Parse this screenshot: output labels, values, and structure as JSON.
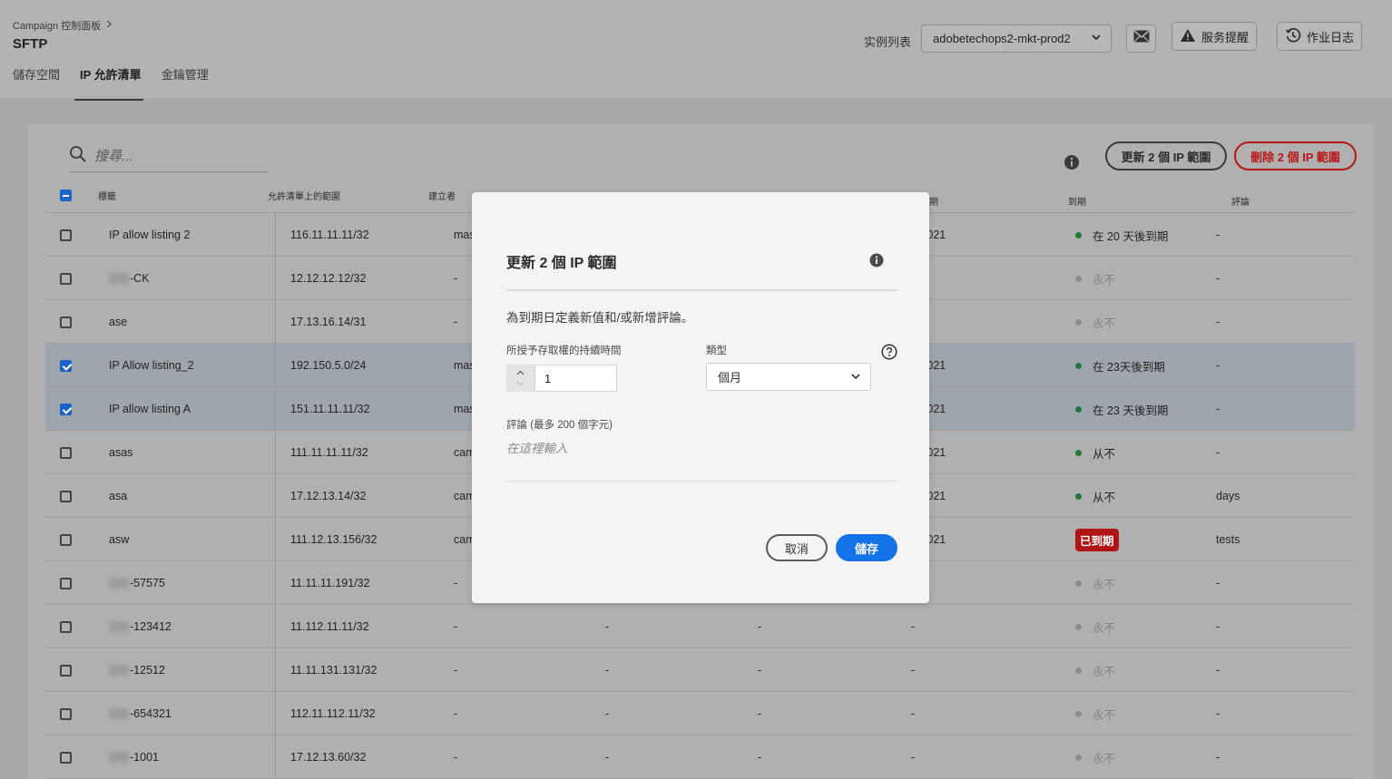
{
  "header": {
    "breadcrumb": "Campaign 控制面板",
    "title": "SFTP",
    "tabs": [
      "儲存空間",
      "IP 允許清單",
      "金鑰管理"
    ],
    "instance_label": "实例列表",
    "instance_value": "adobetechops2-mkt-prod2",
    "service_alerts": "服务提醒",
    "job_log": "作业日志"
  },
  "toolbar": {
    "search_placeholder": "搜尋...",
    "update_button": "更新 2 個 IP 範圍",
    "delete_button": "刪除 2 個 IP 範圍"
  },
  "table": {
    "columns": [
      "標籤",
      "允許清單上的範圍",
      "建立者",
      "期",
      "到期",
      "評論"
    ],
    "rows": [
      {
        "label": "IP allow listing 2",
        "blur": false,
        "range": "116.11.11.11/32",
        "creator": "mas",
        "c4": "",
        "c5": "",
        "date": "1/2021",
        "expiry": "在 20 天後到期",
        "expiry_type": "green",
        "comment": "-",
        "selected": false
      },
      {
        "label": "-CK",
        "blur": true,
        "range": "12.12.12.12/32",
        "creator": "-",
        "c4": "",
        "c5": "",
        "date": "",
        "expiry": "永不",
        "expiry_type": "gray",
        "comment": "-",
        "selected": false
      },
      {
        "label": "ase",
        "blur": false,
        "range": "17.13.16.14/31",
        "creator": "-",
        "c4": "",
        "c5": "",
        "date": "",
        "expiry": "永不",
        "expiry_type": "gray",
        "comment": "-",
        "selected": false
      },
      {
        "label": "IP Allow listing_2",
        "blur": false,
        "range": "192.150.5.0/24",
        "creator": "mas",
        "c4": "",
        "c5": "",
        "date": "5/2021",
        "expiry": "在 23天後到期",
        "expiry_type": "green",
        "comment": "-",
        "selected": true
      },
      {
        "label": "IP allow listing A",
        "blur": false,
        "range": "151.11.11.11/32",
        "creator": "mas",
        "c4": "",
        "c5": "",
        "date": "5/2021",
        "expiry": "在 23 天後到期",
        "expiry_type": "green",
        "comment": "-",
        "selected": true
      },
      {
        "label": "asas",
        "blur": false,
        "range": "111.11.11.11/32",
        "creator": "cam",
        "c4": "",
        "c5": "",
        "date": "5/2021",
        "expiry": "从不",
        "expiry_type": "green",
        "comment": "-",
        "selected": false
      },
      {
        "label": "asa",
        "blur": false,
        "range": "17.12.13.14/32",
        "creator": "cam",
        "c4": "",
        "c5": "",
        "date": "5/2021",
        "expiry": "从不",
        "expiry_type": "green",
        "comment": "days",
        "selected": false
      },
      {
        "label": "asw",
        "blur": false,
        "range": "111.12.13.156/32",
        "creator": "cam",
        "c4": "",
        "c5": "",
        "date": "7/2021",
        "expiry": "已到期",
        "expiry_type": "expired",
        "comment": "tests",
        "selected": false
      },
      {
        "label": "-57575",
        "blur": true,
        "range": "11.11.11.191/32",
        "creator": "-",
        "c4": "",
        "c5": "",
        "date": "",
        "expiry": "永不",
        "expiry_type": "gray",
        "comment": "-",
        "selected": false
      },
      {
        "label": "-123412",
        "blur": true,
        "range": "11.112.11.11/32",
        "creator": "-",
        "c4": "-",
        "c5": "-",
        "date": "-",
        "expiry": "永不",
        "expiry_type": "gray",
        "comment": "-",
        "selected": false
      },
      {
        "label": "-12512",
        "blur": true,
        "range": "11.11.131.131/32",
        "creator": "-",
        "c4": "-",
        "c5": "-",
        "date": "-",
        "expiry": "永不",
        "expiry_type": "gray",
        "comment": "-",
        "selected": false
      },
      {
        "label": "-654321",
        "blur": true,
        "range": "112.11.112.11/32",
        "creator": "-",
        "c4": "-",
        "c5": "-",
        "date": "-",
        "expiry": "永不",
        "expiry_type": "gray",
        "comment": "-",
        "selected": false
      },
      {
        "label": "-1001",
        "blur": true,
        "range": "17.12.13.60/32",
        "creator": "-",
        "c4": "-",
        "c5": "-",
        "date": "-",
        "expiry": "永不",
        "expiry_type": "gray",
        "comment": "-",
        "selected": false
      }
    ]
  },
  "modal": {
    "title": "更新 2 個 IP 範圍",
    "description": "為到期日定義新值和/或新增評論。",
    "duration_label": "所授予存取權的持續時間",
    "duration_value": "1",
    "type_label": "類型",
    "type_value": "個月",
    "comment_label": "評論 (最多 200 個字元)",
    "comment_placeholder": "在這裡輸入",
    "cancel": "取消",
    "save": "儲存"
  },
  "colors": {
    "primary": "#1473e6",
    "danger": "#b81515",
    "success": "#1f7a3c"
  }
}
